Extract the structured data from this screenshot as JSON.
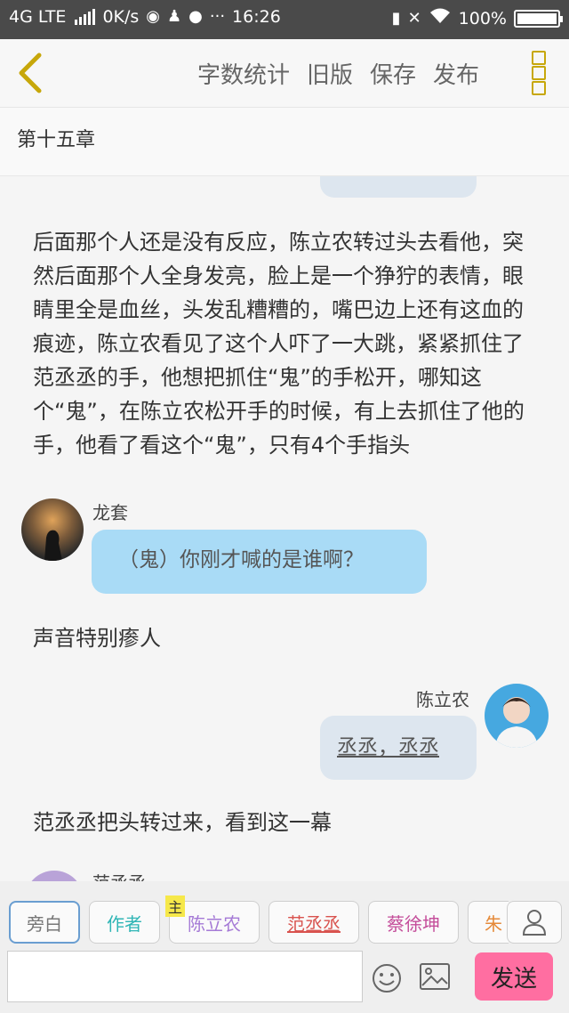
{
  "status_bar": {
    "network": "4G LTE",
    "speed": "0K/s",
    "time": "16:26",
    "battery": "100%",
    "icons": [
      "signal-icon",
      "weibo-icon",
      "qq-icon",
      "chat-icon",
      "more-dots-icon",
      "battery-charge-icon",
      "mute-icon",
      "wifi-icon",
      "battery-icon"
    ]
  },
  "toolbar": {
    "word_count": "字数统计",
    "old_version": "旧版",
    "save": "保存",
    "publish": "发布",
    "accent": "#c7a70a"
  },
  "chapter": {
    "title": "第十五章"
  },
  "content": {
    "para1": "后面那个人还是没有反应，陈立农转过头去看他，突然后面那个人全身发亮，脸上是一个狰狞的表情，眼睛里全是血丝，头发乱糟糟的，嘴巴边上还有这血的痕迹，陈立农看见了这个人吓了一大跳，紧紧抓住了范丞丞的手，他想把抓住“鬼”的手松开，哪知这个“鬼”，在陈立农松开手的时候，有上去抓住了他的手，他看了看这个“鬼”，只有4个手指头",
    "msg1_name": "龙套",
    "msg1_text": "（鬼）你刚才喊的是谁啊？",
    "para2": "声音特别瘆人",
    "msg2_name": "陈立农",
    "msg2_text": "丞丞，丞丞",
    "para3": "范丞丞把头转过来，看到这一幕",
    "msg3_name": "范丞丞"
  },
  "role_bar": {
    "roles": [
      "旁白",
      "作者",
      "陈立农",
      "范丞丞",
      "蔡徐坤",
      "朱"
    ],
    "main_badge": "主",
    "colors": {
      "narrator": "#777777",
      "author": "#2fb5b5",
      "chen": "#a57ad6",
      "fan": "#d9534f",
      "cai": "#c44d9a",
      "zhu": "#e58a3a"
    }
  },
  "input_bar": {
    "input_value": "",
    "send": "发送",
    "send_color": "#ff6ea1"
  }
}
